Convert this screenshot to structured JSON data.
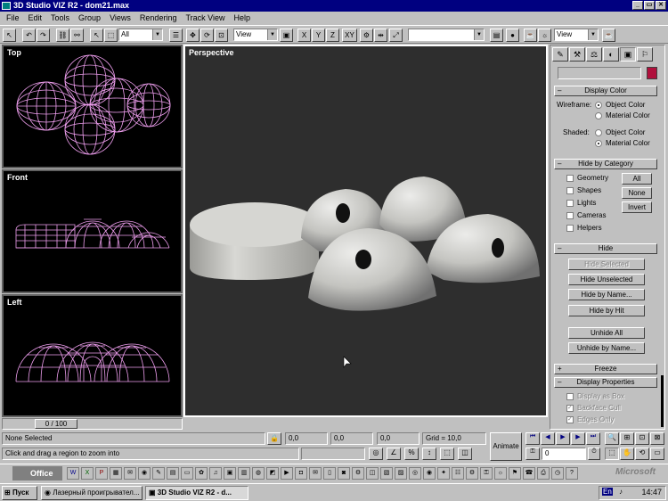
{
  "window": {
    "title": "3D Studio VIZ R2 - dom21.max"
  },
  "menu": [
    "File",
    "Edit",
    "Tools",
    "Group",
    "Views",
    "Rendering",
    "Track View",
    "Help"
  ],
  "toolbar": {
    "select_filter": "All",
    "ref_coord": "View",
    "axis_x": "X",
    "axis_y": "Y",
    "axis_z": "Z",
    "axis_xy": "XY",
    "named_selection": "",
    "render_view": "View"
  },
  "viewports": {
    "top": "Top",
    "front": "Front",
    "left": "Left",
    "perspective": "Perspective"
  },
  "timeslider": {
    "label": "0 / 100"
  },
  "panel": {
    "display_color": {
      "title": "Display Color",
      "wireframe_label": "Wireframe:",
      "shaded_label": "Shaded:",
      "object_color": "Object Color",
      "material_color": "Material Color"
    },
    "hide_by_category": {
      "title": "Hide by Category",
      "items": [
        "Geometry",
        "Shapes",
        "Lights",
        "Cameras",
        "Helpers"
      ],
      "all": "All",
      "none": "None",
      "invert": "Invert"
    },
    "hide": {
      "title": "Hide",
      "hide_selected": "Hide Selected",
      "hide_unselected": "Hide Unselected",
      "hide_by_name": "Hide by Name...",
      "hide_by_hit": "Hide by Hit",
      "unhide_all": "Unhide All",
      "unhide_by_name": "Unhide by Name..."
    },
    "freeze": {
      "title": "Freeze"
    },
    "display_properties": {
      "title": "Display Properties",
      "display_as_box": "Display as Box",
      "backface_cull": "Backface Cull",
      "edges_only": "Edges Only"
    }
  },
  "status": {
    "selection": "None Selected",
    "prompt": "Click and drag a region to zoom into",
    "x": "0,0",
    "y": "0,0",
    "z": "0,0",
    "grid": "Grid = 10,0",
    "animate": "Animate",
    "frame": "0"
  },
  "officebar": {
    "label": "Office",
    "brand": "Microsoft"
  },
  "taskbar": {
    "start": "Пуск",
    "tasks": [
      "Лазерный проигрывател...",
      "3D Studio VIZ R2 - d..."
    ],
    "lang": "En",
    "time": "14:47"
  },
  "colors": {
    "wire": "#ee9eee",
    "titlebar": "#000080",
    "swatch": "#b0103c"
  }
}
